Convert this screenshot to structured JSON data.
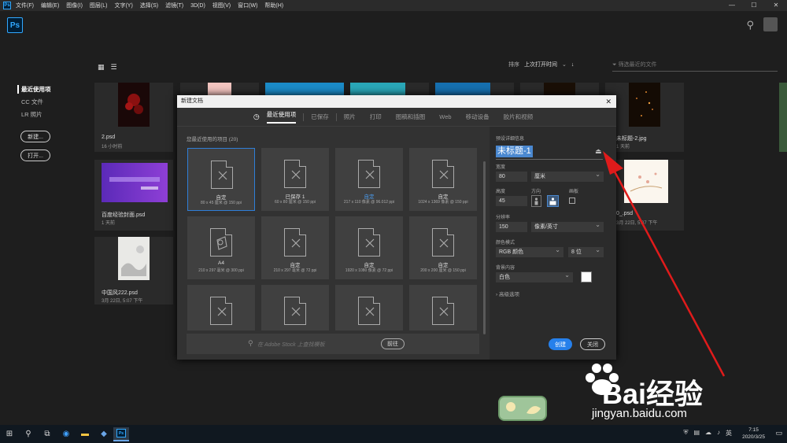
{
  "menubar": {
    "items": [
      "文件(F)",
      "编辑(E)",
      "图像(I)",
      "图层(L)",
      "文字(Y)",
      "选择(S)",
      "滤镜(T)",
      "3D(D)",
      "视图(V)",
      "窗口(W)",
      "帮助(H)"
    ],
    "window_controls": [
      "—",
      "☐",
      "✕"
    ]
  },
  "app": {
    "logo": "Ps"
  },
  "home": {
    "sidenav": [
      "最近使用项",
      "CC 文件",
      "LR 照片"
    ],
    "new_button": "新建...",
    "open_button": "打开...",
    "sort_label": "排序",
    "sort_value": "上次打开时间",
    "filter_placeholder": "筛选最近的文件",
    "files": [
      {
        "name": "2.psd",
        "date": "16 小时前"
      },
      {
        "name": "百度经验封面.psd",
        "date": "1 天前"
      },
      {
        "name": "中国风222.psd",
        "date": "3月 22日, 5:07 下午"
      },
      {
        "name": "未标题-2.jpg",
        "date": "1 天前"
      },
      {
        "name": "0_.psd",
        "date": "3月 22日, 5:07 下午"
      }
    ]
  },
  "dialog": {
    "title": "新建文档",
    "tabs": [
      "最近使用项",
      "已保存",
      "照片",
      "打印",
      "图稿和插图",
      "Web",
      "移动设备",
      "胶片和视频"
    ],
    "recent_header": "您最近使用的项目 (20)",
    "presets": [
      {
        "name": "自定",
        "detail": "80 x 45 厘米 @ 150 ppi"
      },
      {
        "name": "已保存 1",
        "detail": "60 x 80 厘米 @ 150 ppi"
      },
      {
        "name": "自定",
        "detail": "217 x 110 像素 @ 96.012 ppi"
      },
      {
        "name": "自定",
        "detail": "1024 x 1369 像素 @ 150 ppi"
      },
      {
        "name": "A4",
        "detail": "210 x 297 毫米 @ 300 ppi"
      },
      {
        "name": "自定",
        "detail": "210 x 297 毫米 @ 72 ppi"
      },
      {
        "name": "自定",
        "detail": "1920 x 1080 像素 @ 72 ppi"
      },
      {
        "name": "自定",
        "detail": "200 x 200 厘米 @ 150 ppi"
      }
    ],
    "stock_placeholder": "在 Adobe Stock 上查找模板",
    "stock_go": "前往",
    "details_header": "预设详细信息",
    "doc_name": "未标题-1",
    "width_label": "宽度",
    "width_value": "80",
    "width_unit": "厘米",
    "height_label": "高度",
    "height_value": "45",
    "orientation_label": "方向",
    "artboard_label": "画板",
    "resolution_label": "分辨率",
    "resolution_value": "150",
    "resolution_unit": "像素/英寸",
    "color_mode_label": "颜色模式",
    "color_mode_value": "RGB 颜色",
    "bit_depth": "8 位",
    "background_label": "背景内容",
    "background_value": "白色",
    "advanced_label": "高级选项",
    "create_button": "创建",
    "close_button": "关闭"
  },
  "taskbar": {
    "time": "7:15",
    "date": "2020/3/25"
  },
  "watermark": {
    "brand": "Bai经验",
    "url": "jingyan.baidu.com"
  }
}
